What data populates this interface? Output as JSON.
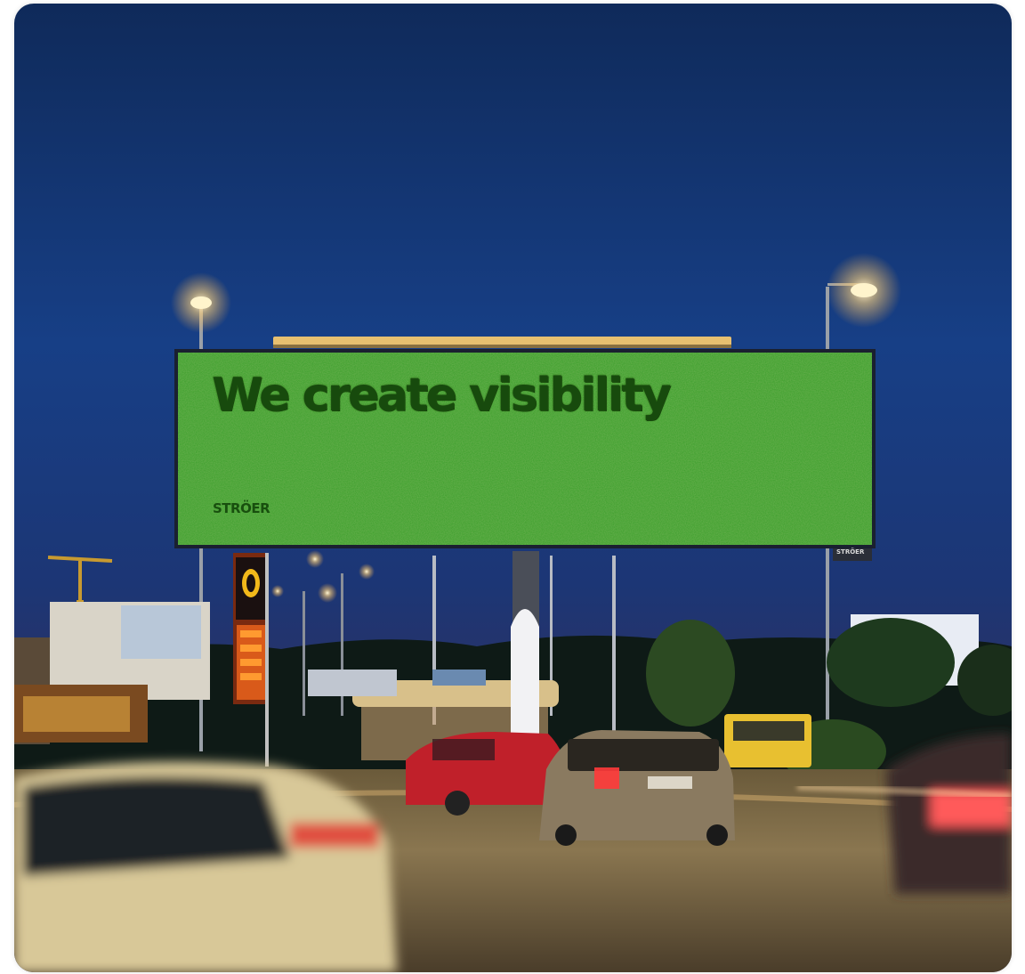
{
  "billboard": {
    "headline": "We create visibility",
    "logo": "STRÖER",
    "frame_plate": "STRÖER"
  },
  "colors": {
    "sky_top": "#0e2c5e",
    "sky_horizon": "#24336e",
    "billboard_green": "#3a9e2a",
    "headline_green": "#174a0d",
    "street_light": "#ffd27a"
  }
}
